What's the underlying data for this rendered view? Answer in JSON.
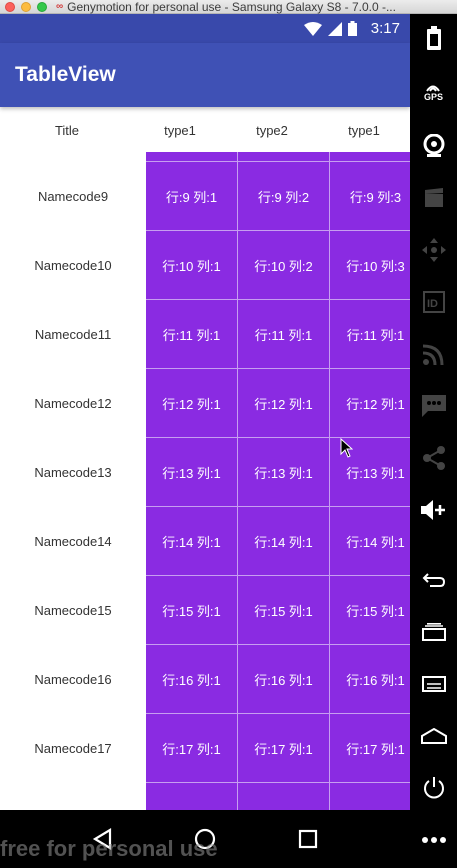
{
  "window": {
    "title": "Genymotion for personal use - Samsung Galaxy S8 - 7.0.0 -..."
  },
  "status_bar": {
    "time": "3:17"
  },
  "app_bar": {
    "title": "TableView"
  },
  "table": {
    "header": {
      "title": "Title",
      "columns": [
        "type1",
        "type2",
        "type1"
      ]
    },
    "rows": [
      {
        "name": [
          "Name",
          "code9"
        ],
        "cells": [
          "行:9 列:1",
          "行:9 列:2",
          "行:9 列:3"
        ]
      },
      {
        "name": [
          "Name",
          "code10"
        ],
        "cells": [
          "行:10 列:1",
          "行:10 列:2",
          "行:10 列:3"
        ]
      },
      {
        "name": [
          "Name",
          "code11"
        ],
        "cells": [
          "行:11 列:1",
          "行:11 列:1",
          "行:11 列:1"
        ]
      },
      {
        "name": [
          "Name",
          "code12"
        ],
        "cells": [
          "行:12 列:1",
          "行:12 列:1",
          "行:12 列:1"
        ]
      },
      {
        "name": [
          "Name",
          "code13"
        ],
        "cells": [
          "行:13 列:1",
          "行:13 列:1",
          "行:13 列:1"
        ]
      },
      {
        "name": [
          "Name",
          "code14"
        ],
        "cells": [
          "行:14 列:1",
          "行:14 列:1",
          "行:14 列:1"
        ]
      },
      {
        "name": [
          "Name",
          "code15"
        ],
        "cells": [
          "行:15 列:1",
          "行:15 列:1",
          "行:15 列:1"
        ]
      },
      {
        "name": [
          "Name",
          "code16"
        ],
        "cells": [
          "行:16 列:1",
          "行:16 列:1",
          "行:16 列:1"
        ]
      },
      {
        "name": [
          "Name",
          "code17"
        ],
        "cells": [
          "行:17 列:1",
          "行:17 列:1",
          "行:17 列:1"
        ]
      },
      {
        "name": [
          "Name",
          ""
        ],
        "cells": [
          "",
          "",
          ""
        ]
      }
    ]
  },
  "watermark": "free for personal use",
  "sidebar": {
    "gps_label": "GPS",
    "items": [
      "battery-icon",
      "gps-icon",
      "webcam-icon",
      "video-capture-icon",
      "dpad-icon",
      "identifiers-icon",
      "cast-icon",
      "sms-icon",
      "share-icon",
      "volume-up-icon",
      "back-icon",
      "recent-apps-icon",
      "menu-icon",
      "home-icon",
      "power-icon",
      "more-icon"
    ]
  },
  "colors": {
    "status_bar": "#3949ab",
    "app_bar": "#3f51b5",
    "cell": "#8a2be2"
  }
}
